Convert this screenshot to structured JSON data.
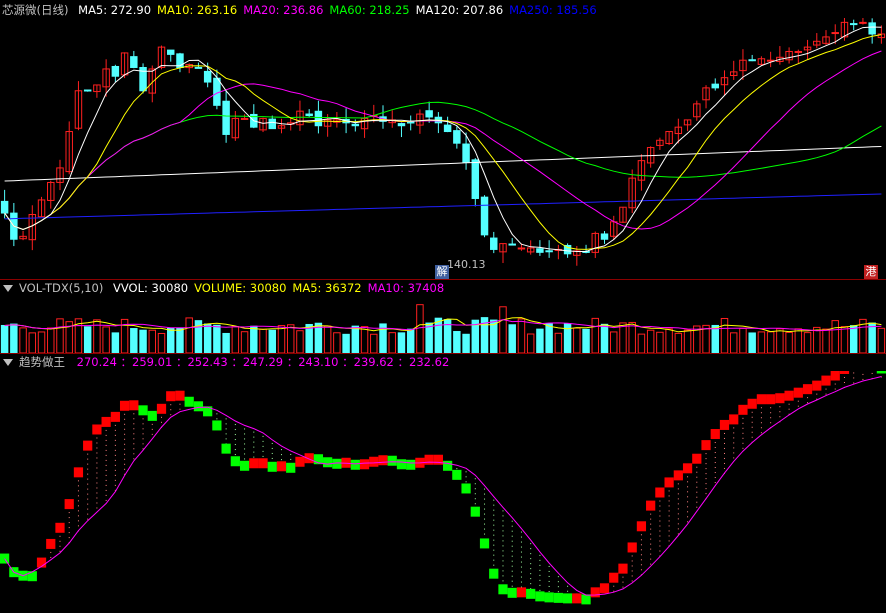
{
  "price_panel": {
    "title": "芯源微(日线)",
    "ma": [
      {
        "label": "MA5: 272.90",
        "color": "#ffffff"
      },
      {
        "label": "MA10: 263.16",
        "color": "#ffff00"
      },
      {
        "label": "MA20: 236.86",
        "color": "#ff00ff"
      },
      {
        "label": "MA60: 218.25",
        "color": "#00ff00"
      },
      {
        "label": "MA120: 207.86",
        "color": "#ffffff"
      },
      {
        "label": "MA250: 185.56",
        "color": "#0000ff"
      }
    ],
    "low_label": "140.13",
    "tag_left": "解",
    "tag_right": "港"
  },
  "volume_panel": {
    "title": "VOL-TDX(5,10)",
    "items": [
      {
        "label": "VVOL: 30080",
        "color": "#ffffff"
      },
      {
        "label": "VOLUME: 30080",
        "color": "#ffff00"
      },
      {
        "label": "MA5: 36372",
        "color": "#ffff00"
      },
      {
        "label": "MA10: 37408",
        "color": "#ff00ff"
      }
    ]
  },
  "trend_panel": {
    "title": "趋势做王",
    "values": "270.24 ：259.01 ：252.43 ：247.29 ：243.10 ：239.62 ：232.62",
    "values_color": "#ff00ff"
  },
  "colors": {
    "up": "#ff2020",
    "down": "#54ffff",
    "bg": "#000000",
    "grid": "#8b0000",
    "ma5": "#ffffff",
    "ma10": "#ffff00",
    "ma20": "#ff00ff",
    "ma60": "#00ff00",
    "ma120": "#ffffff",
    "ma250": "#2020ff"
  },
  "chart_data": {
    "type": "candlestick",
    "closes": [
      176,
      158,
      160,
      175,
      185,
      197,
      207,
      232,
      260,
      260,
      264,
      275,
      270,
      286,
      276,
      260,
      275,
      290,
      285,
      276,
      278,
      276,
      266,
      250,
      230,
      241,
      241,
      235,
      241,
      234,
      236,
      238,
      246,
      243,
      236,
      240,
      240,
      238,
      236,
      241,
      243,
      239,
      240,
      236,
      238,
      244,
      242,
      238,
      232,
      224,
      211,
      186,
      161,
      151,
      155,
      154,
      152,
      152,
      149,
      150,
      151,
      148,
      150,
      149,
      162,
      158,
      170,
      180,
      200,
      212,
      221,
      226,
      232,
      235,
      240,
      251,
      262,
      262,
      269,
      273,
      281,
      281,
      282,
      281,
      283,
      287,
      287,
      290,
      294,
      297,
      300,
      307,
      306,
      307,
      299,
      299
    ]
  }
}
